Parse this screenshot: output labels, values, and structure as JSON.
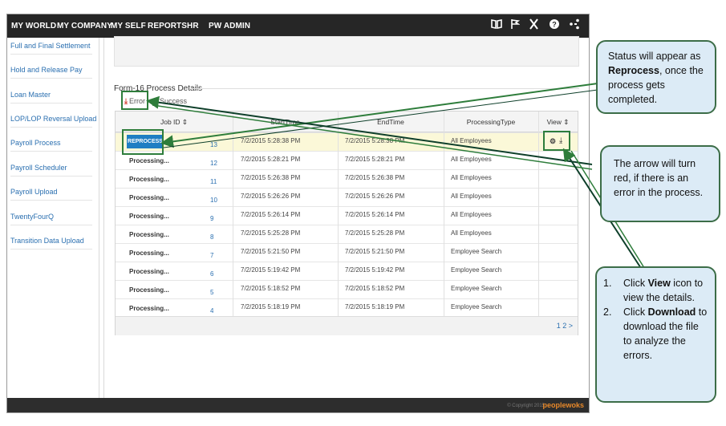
{
  "topnav": {
    "items": [
      "MY WORLD",
      "MY COMPANY",
      "MY SELF",
      "REPORTS",
      "HR",
      "PW ADMIN"
    ],
    "icons": [
      "book-icon",
      "flag-icon",
      "tools-icon",
      "help-icon",
      "share-icon"
    ]
  },
  "sidebar": {
    "items": [
      "Full and Final Settlement",
      "Hold and Release Pay",
      "Loan Master",
      "LOP/LOP Reversal Upload",
      "Payroll Process",
      "Payroll Scheduler",
      "Payroll Upload",
      "TwentyFourQ",
      "Transition Data Upload"
    ]
  },
  "section": {
    "title": "Form-16 Process Details",
    "legend_error": "Error",
    "legend_success": "Success"
  },
  "grid": {
    "headers": [
      "Job ID",
      "StartTime",
      "EndTime",
      "ProcessingType",
      "View"
    ],
    "reprocess_label": "REPROCESS",
    "rows": [
      {
        "status": "REPROCESS",
        "job_id": "13",
        "start": "7/2/2015 5:28:38 PM",
        "end": "7/2/2015 5:28:38 PM",
        "type": "All Employees"
      },
      {
        "status": "Processing...",
        "job_id": "12",
        "start": "7/2/2015 5:28:21 PM",
        "end": "7/2/2015 5:28:21 PM",
        "type": "All Employees"
      },
      {
        "status": "Processing...",
        "job_id": "11",
        "start": "7/2/2015 5:26:38 PM",
        "end": "7/2/2015 5:26:38 PM",
        "type": "All Employees"
      },
      {
        "status": "Processing...",
        "job_id": "10",
        "start": "7/2/2015 5:26:26 PM",
        "end": "7/2/2015 5:26:26 PM",
        "type": "All Employees"
      },
      {
        "status": "Processing...",
        "job_id": "9",
        "start": "7/2/2015 5:26:14 PM",
        "end": "7/2/2015 5:26:14 PM",
        "type": "All Employees"
      },
      {
        "status": "Processing...",
        "job_id": "8",
        "start": "7/2/2015 5:25:28 PM",
        "end": "7/2/2015 5:25:28 PM",
        "type": "All Employees"
      },
      {
        "status": "Processing...",
        "job_id": "7",
        "start": "7/2/2015 5:21:50 PM",
        "end": "7/2/2015 5:21:50 PM",
        "type": "Employee Search"
      },
      {
        "status": "Processing...",
        "job_id": "6",
        "start": "7/2/2015 5:19:42 PM",
        "end": "7/2/2015 5:19:42 PM",
        "type": "Employee Search"
      },
      {
        "status": "Processing...",
        "job_id": "5",
        "start": "7/2/2015 5:18:52 PM",
        "end": "7/2/2015 5:18:52 PM",
        "type": "Employee Search"
      },
      {
        "status": "Processing...",
        "job_id": "4",
        "start": "7/2/2015 5:18:19 PM",
        "end": "7/2/2015 5:18:19 PM",
        "type": "Employee Search"
      }
    ],
    "pager": "1 2 >"
  },
  "footer": {
    "copyright": "© Copyright 2015",
    "brand": "peoplewoks"
  },
  "callouts": {
    "status": {
      "pre": "Status will appear as ",
      "bold": "Reprocess",
      "post": ", once the process gets completed."
    },
    "arrow": "The arrow will turn red, if there is an error in the process.",
    "steps": [
      {
        "num": "1.",
        "pre": "Click ",
        "bold": "View",
        "post": " icon to view the details."
      },
      {
        "num": "2.",
        "pre": "Click ",
        "bold": "Download",
        "post": " to download the file to analyze the errors."
      }
    ]
  },
  "colors": {
    "nav_bg": "#262626",
    "link": "#2a6fb0",
    "reprocess_btn": "#1f7ec3",
    "highlight_row": "#fbf8d8",
    "callout_bg": "#dcebf6",
    "callout_border": "#3c6d48",
    "error_icon": "#d23a2a"
  }
}
